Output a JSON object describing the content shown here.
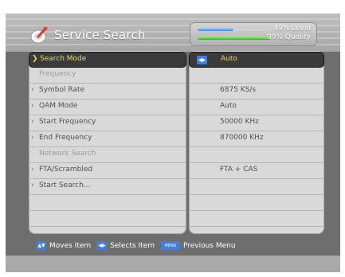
{
  "header": {
    "title": "Service Search",
    "title_icon": "satellite-dish-icon"
  },
  "signal": {
    "level_text": "49% Level",
    "quality_text": "99% Quality",
    "level_value": 0.49,
    "quality_value": 0.99
  },
  "menu": {
    "items": [
      {
        "label": "Search Mode",
        "value": "Auto",
        "selected": true,
        "enabled": true
      },
      {
        "label": "Frequency",
        "value": "",
        "selected": false,
        "enabled": false
      },
      {
        "label": "Symbol Rate",
        "value": "6875 KS/s",
        "selected": false,
        "enabled": true
      },
      {
        "label": "QAM Mode",
        "value": "Auto",
        "selected": false,
        "enabled": true
      },
      {
        "label": "Start Frequency",
        "value": "50000 KHz",
        "selected": false,
        "enabled": true
      },
      {
        "label": "End Frequency",
        "value": "870000 KHz",
        "selected": false,
        "enabled": true
      },
      {
        "label": "Network Search",
        "value": "",
        "selected": false,
        "enabled": false
      },
      {
        "label": "FTA/Scrambled",
        "value": "FTA + CAS",
        "selected": false,
        "enabled": true
      },
      {
        "label": "Start Search...",
        "value": "",
        "selected": false,
        "enabled": true
      }
    ]
  },
  "footer": {
    "move_label": "Moves Item",
    "select_label": "Selects Item",
    "menu_key": "MENU",
    "previous_label": "Previous Menu"
  },
  "colors": {
    "accent": "#f2d84b",
    "key_blue": "#3f7ee6",
    "panel": "#d9d9d9",
    "screen_bg": "#6e6e6e"
  }
}
